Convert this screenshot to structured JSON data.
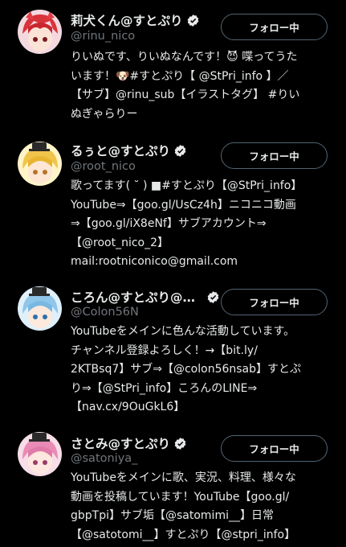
{
  "follow_label": "フォロー中",
  "accounts": [
    {
      "name": "莉犬くん@すとぷり",
      "handle": "@rinu_nico",
      "bio_lines": [
        "りいぬです、りいぬなんです！😈 喋ってうた",
        "います！🐶#すとぷり【 @StPri_info 】／",
        "【サブ】@rinu_sub【イラストタグ】 #りい",
        "ぬぎゃらりー"
      ]
    },
    {
      "name": "るぅと@すとぷり",
      "handle": "@root_nico",
      "bio_lines": [
        "歌ってます( ˘ ) ■#すとぷり【@StPri_info】",
        "YouTube⇒【goo.gl/UsCz4h】ニコニコ動画",
        "⇒【goo.gl/iX8eNf】サブアカウント⇒",
        "【@root_nico_2】",
        "mail:rootniconico@gmail.com"
      ]
    },
    {
      "name": "ころん@すとぷり@生…",
      "handle": "@Colon56N",
      "bio_lines": [
        "YouTubeをメインに色んな活動しています。",
        "チャンネル登録よろしく！→【bit.ly/",
        "2KTBsq7】サブ⇒【@colon56nsab】すとぷ",
        "り⇒【@StPri_info】ころんのLINE⇒",
        "【nav.cx/9OuGkL6】"
      ]
    },
    {
      "name": "さとみ@すとぷり",
      "handle": "@satoniya_",
      "bio_lines": [
        "YouTubeをメインに歌、実況、料理、様々な",
        "動画を投稿しています！YouTube【goo.gl/",
        "gbpTpi】サブ垢【@satomimi__】日常",
        "【@satotomi__】すとぷり【@stpri_info】"
      ]
    }
  ]
}
